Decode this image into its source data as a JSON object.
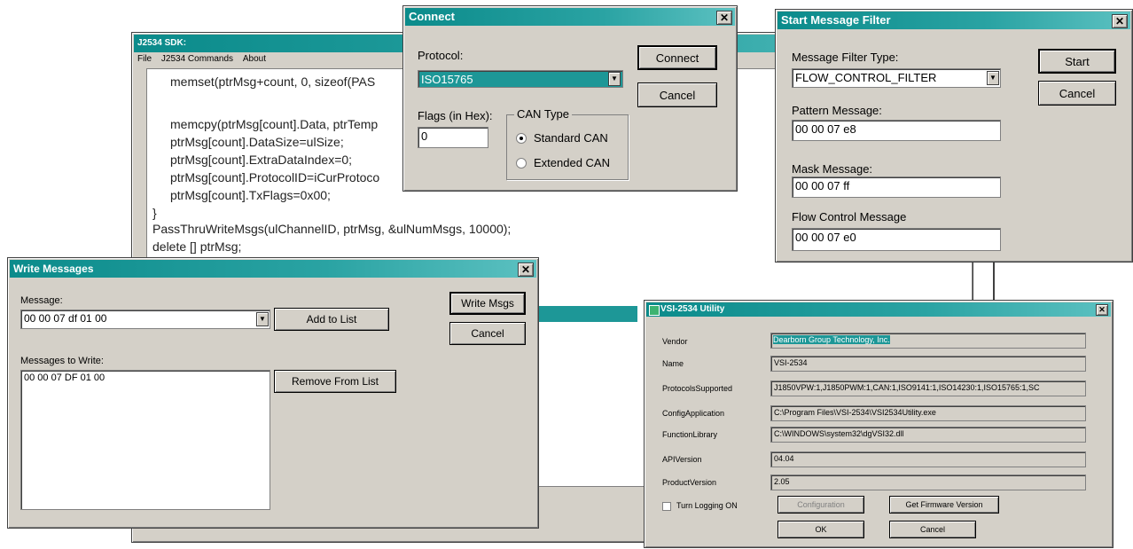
{
  "sdk": {
    "title": "J2534 SDK:",
    "menu": [
      "File",
      "J2534 Commands",
      "About"
    ],
    "code": [
      "memset(ptrMsg+count, 0, sizeof(PAS",
      "memcpy(ptrMsg[count].Data, ptrTemp",
      "ptrMsg[count].DataSize=ulSize;",
      "ptrMsg[count].ExtraDataIndex=0;",
      "ptrMsg[count].ProtocolID=iCurProtoco",
      "ptrMsg[count].TxFlags=0x00;",
      "}",
      "PassThruWriteMsgs(ulChannelID, ptrMsg, &ulNumMsgs, 10000);",
      "delete [] ptrMsg;"
    ]
  },
  "connect": {
    "title": "Connect",
    "protocol_label": "Protocol:",
    "protocol_value": "ISO15765",
    "flags_label": "Flags (in Hex):",
    "flags_value": "0",
    "can_type_label": "CAN Type",
    "standard_can": "Standard CAN",
    "extended_can": "Extended CAN",
    "connect_button": "Connect",
    "cancel_button": "Cancel"
  },
  "filter": {
    "title": "Start Message Filter",
    "type_label": "Message Filter Type:",
    "type_value": "FLOW_CONTROL_FILTER",
    "pattern_label": "Pattern Message:",
    "pattern_value": "00 00 07 e8",
    "mask_label": "Mask Message:",
    "mask_value": "00 00 07 ff",
    "flow_label": "Flow Control Message",
    "flow_value": "00 00 07 e0",
    "start_button": "Start",
    "cancel_button": "Cancel"
  },
  "write": {
    "title": "Write Messages",
    "message_label": "Message:",
    "message_value": "00 00 07 df 01 00",
    "add_button": "Add to List",
    "write_button": "Write Msgs",
    "cancel_button": "Cancel",
    "list_label": "Messages to Write:",
    "list_items": [
      "00 00 07 DF 01 00"
    ],
    "remove_button": "Remove From List"
  },
  "utility": {
    "title": "VSI-2534 Utility",
    "rows": [
      {
        "label": "Vendor",
        "value": "Dearborn Group Technology, Inc."
      },
      {
        "label": "Name",
        "value": "VSI-2534"
      },
      {
        "label": "ProtocolsSupported",
        "value": "J1850VPW:1,J1850PWM:1,CAN:1,ISO9141:1,ISO14230:1,ISO15765:1,SC"
      },
      {
        "label": "ConfigApplication",
        "value": "C:\\Program Files\\VSI-2534\\VSI2534Utility.exe"
      },
      {
        "label": "FunctionLibrary",
        "value": "C:\\WINDOWS\\system32\\dgVSI32.dll"
      },
      {
        "label": "APIVersion",
        "value": "04.04"
      },
      {
        "label": "ProductVersion",
        "value": "2.05"
      }
    ],
    "logging_label": "Turn Logging ON",
    "configuration_button": "Configuration",
    "firmware_button": "Get Firmware Version",
    "ok_button": "OK",
    "cancel_button": "Cancel"
  }
}
